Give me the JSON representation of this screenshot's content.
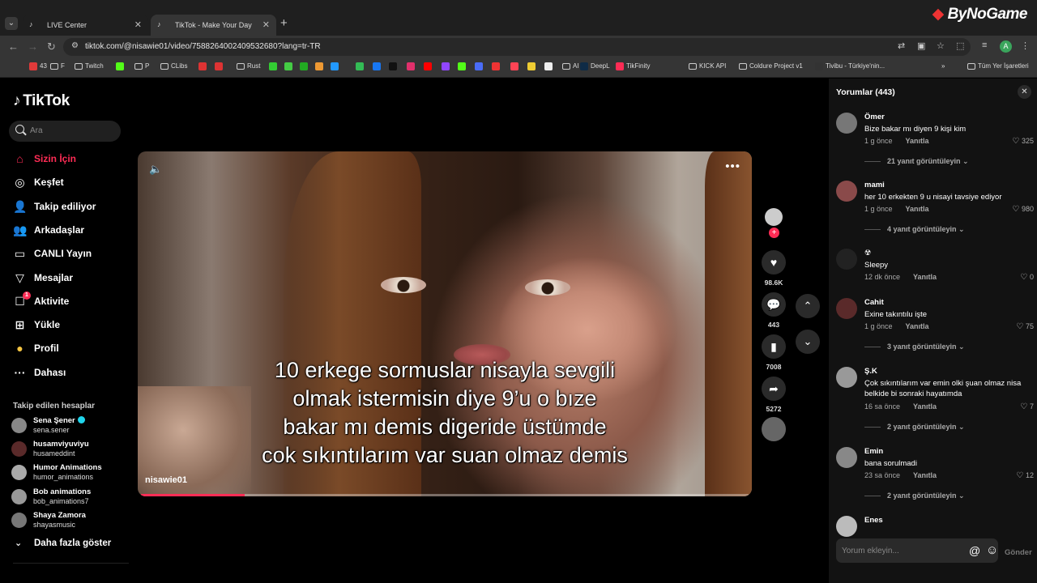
{
  "browser": {
    "tabs": [
      {
        "label": "LIVE Center",
        "icon": "tiktok-icon"
      },
      {
        "label": "TikTok - Make Your Day",
        "icon": "tiktok-icon"
      }
    ],
    "new_tab": "+",
    "url": "tiktok.com/@nisawie01/video/7588264002409532680?lang=tr-TR",
    "brand_overlay": "ByNoGame",
    "profile_initial": "A",
    "bookmarks": [
      {
        "label": "43",
        "color": "#e03a3a"
      },
      {
        "label": "F",
        "color": "folder"
      },
      {
        "label": "Twitch",
        "color": "folder"
      },
      {
        "label": "",
        "color": "#53fc18"
      },
      {
        "label": "P",
        "color": "folder"
      },
      {
        "label": "CLibs",
        "color": "folder"
      },
      {
        "label": "",
        "color": "#d33"
      },
      {
        "label": "",
        "color": "#d33"
      },
      {
        "label": "Rust",
        "color": "folder"
      },
      {
        "label": "",
        "color": "#3c3"
      },
      {
        "label": "",
        "color": "#4c4"
      },
      {
        "label": "",
        "color": "#2a2"
      },
      {
        "label": "",
        "color": "#e93"
      },
      {
        "label": "",
        "color": "#29f"
      },
      {
        "label": "",
        "color": "#3b5"
      },
      {
        "label": "",
        "color": "#1877f2"
      },
      {
        "label": "",
        "color": "#111"
      },
      {
        "label": "",
        "color": "#e1306c"
      },
      {
        "label": "",
        "color": "#f00"
      },
      {
        "label": "",
        "color": "#9146ff"
      },
      {
        "label": "",
        "color": "#53fc18"
      },
      {
        "label": "",
        "color": "#4a6cf7"
      },
      {
        "label": "",
        "color": "#e33"
      },
      {
        "label": "",
        "color": "#f45"
      },
      {
        "label": "",
        "color": "#ec3"
      },
      {
        "label": "",
        "color": "#eee"
      },
      {
        "label": "AI",
        "color": "folder"
      },
      {
        "label": "DeepL",
        "color": "#0f2b46"
      },
      {
        "label": "TikFinity",
        "color": "#fe2c55"
      },
      {
        "label": "KICK API",
        "color": "folder"
      },
      {
        "label": "Coldure Project v1",
        "color": "folder"
      },
      {
        "label": "Tivibu - Türkiye'nin...",
        "color": "#333"
      }
    ],
    "all_bookmarks": "Tüm Yer İşaretleri"
  },
  "sidebar": {
    "logo": "TikTok",
    "search_placeholder": "Ara",
    "menu": [
      {
        "label": "Sizin İçin",
        "icon": "home-icon",
        "active": true
      },
      {
        "label": "Keşfet",
        "icon": "compass-icon"
      },
      {
        "label": "Takip ediliyor",
        "icon": "following-icon"
      },
      {
        "label": "Arkadaşlar",
        "icon": "friends-icon"
      },
      {
        "label": "CANLI Yayın",
        "icon": "live-icon"
      },
      {
        "label": "Mesajlar",
        "icon": "messages-icon"
      },
      {
        "label": "Aktivite",
        "icon": "activity-icon",
        "badge": "1"
      },
      {
        "label": "Yükle",
        "icon": "upload-icon"
      },
      {
        "label": "Profil",
        "icon": "profile-icon"
      },
      {
        "label": "Dahası",
        "icon": "more-icon"
      }
    ],
    "following_header": "Takip edilen hesaplar",
    "following": [
      {
        "name": "Sena Şener",
        "username": "sena.sener",
        "verified": true
      },
      {
        "name": "husamviyuviyu",
        "username": "husameddint"
      },
      {
        "name": "Humor Animations",
        "username": "humor_animations"
      },
      {
        "name": "Bob animations",
        "username": "bob_animations7"
      },
      {
        "name": "Shaya  Zamora",
        "username": "shayasmusic"
      }
    ],
    "show_more": "Daha fazla göster"
  },
  "video": {
    "caption": [
      "10 erkege sormuslar nisayla sevgili",
      "olmak istermisin diye 9’u o bıze",
      "bakar mı demis digeride üstümde",
      "cok sıkıntılarım var suan olmaz demis"
    ],
    "author": "nisawie01",
    "progress": 0.17,
    "likes": "98.6K",
    "comments": "443",
    "saves": "7008",
    "shares": "5272"
  },
  "comments_panel": {
    "title": "Yorumlar (443)",
    "items": [
      {
        "name": "Ömer",
        "text": "Bize bakar mı diyen 9 kişi kim",
        "time": "1 g önce",
        "reply": "Yanıtla",
        "likes": "325",
        "more": "21 yanıt görüntüleyin"
      },
      {
        "name": "mami",
        "text": "her 10 erkekten 9 u nisayi tavsiye ediyor",
        "time": "1 g önce",
        "reply": "Yanıtla",
        "likes": "980",
        "more": "4 yanıt görüntüleyin"
      },
      {
        "name": "☢",
        "text": "Sleepy",
        "time": "12 dk önce",
        "reply": "Yanıtla",
        "likes": "0",
        "more": ""
      },
      {
        "name": "Cahit",
        "text": "Exine takıntılu işte",
        "time": "1 g önce",
        "reply": "Yanıtla",
        "likes": "75",
        "more": "3 yanıt görüntüleyin"
      },
      {
        "name": "Ş.K",
        "text": "Çok sıkıntılarım var emin olki şuan olmaz nisa belkide bi sonraki hayatımda",
        "time": "16 sa önce",
        "reply": "Yanıtla",
        "likes": "7",
        "more": "2 yanıt görüntüleyin"
      },
      {
        "name": "Emin",
        "text": "bana sorulmadi",
        "time": "23 sa önce",
        "reply": "Yanıtla",
        "likes": "12",
        "more": "2 yanıt görüntüleyin"
      },
      {
        "name": "Enes",
        "text": "",
        "time": "",
        "reply": "",
        "likes": "",
        "more": ""
      }
    ],
    "input_placeholder": "Yorum ekleyin...",
    "send_label": "Gönder"
  }
}
